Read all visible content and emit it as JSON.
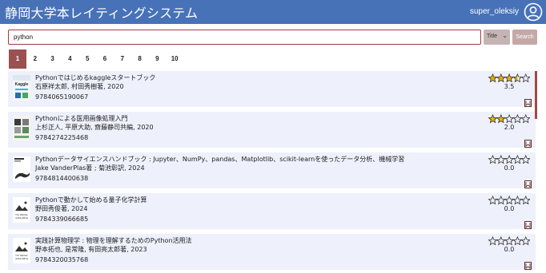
{
  "app": {
    "title": "静岡大学本レイティングシステム"
  },
  "user": {
    "name": "super_oleksiy",
    "icon": "user-circle-icon"
  },
  "search": {
    "value": "python",
    "field": "Title",
    "button_label": "Search"
  },
  "pagination": {
    "pages": [
      "1",
      "2",
      "3",
      "4",
      "5",
      "6",
      "7",
      "8",
      "9",
      "10"
    ],
    "active": "1"
  },
  "books": [
    {
      "title": "Pythonではじめるkaggleスタートブック",
      "authors": "石原祥太郎, 村田秀樹著, 2020",
      "isbn": "9784065190067",
      "rating": 3.5,
      "rating_label": "3.5",
      "thumb": "kaggle-cover",
      "bookmarked": true
    },
    {
      "title": "Pythonによる医用画像処理入門",
      "authors": "上杉正人, 平原大助, 齋藤静司共編, 2020",
      "isbn": "9784274225468",
      "rating": 2.0,
      "rating_label": "2.0",
      "thumb": "medical-cover",
      "bookmarked": true
    },
    {
      "title": "Pythonデータサイエンスハンドブック : Jupyter、NumPy、pandas、Matplotlib、scikit-learnを使ったデータ分析、機械学習",
      "authors": "Jake VanderPlas著 ; 菊池彰訳, 2024",
      "isbn": "9784814400638",
      "rating": 0.0,
      "rating_label": "0.0",
      "thumb": "lizard-cover",
      "bookmarked": false
    },
    {
      "title": "Pythonで動かして始める量子化学計算",
      "authors": "野田秀俊著, 2024",
      "isbn": "9784339066685",
      "rating": 0.0,
      "rating_label": "0.0",
      "thumb": "no-image",
      "bookmarked": false
    },
    {
      "title": "実践計算物理学 : 物理を理解するためのPython活用法",
      "authors": "野本拓也, 是常隆, 有田亮太郎著, 2023",
      "isbn": "9784320035768",
      "rating": 0.0,
      "rating_label": "0.0",
      "thumb": "no-image",
      "bookmarked": false
    }
  ],
  "thumb_text": {
    "no_image": "NO IMAGE AVAILABLE",
    "kaggle_logo": "Kaggle"
  },
  "colors": {
    "header": "#4772b8",
    "accent": "#9b5151",
    "card": "#eef0fb",
    "star": "#e6b400"
  }
}
